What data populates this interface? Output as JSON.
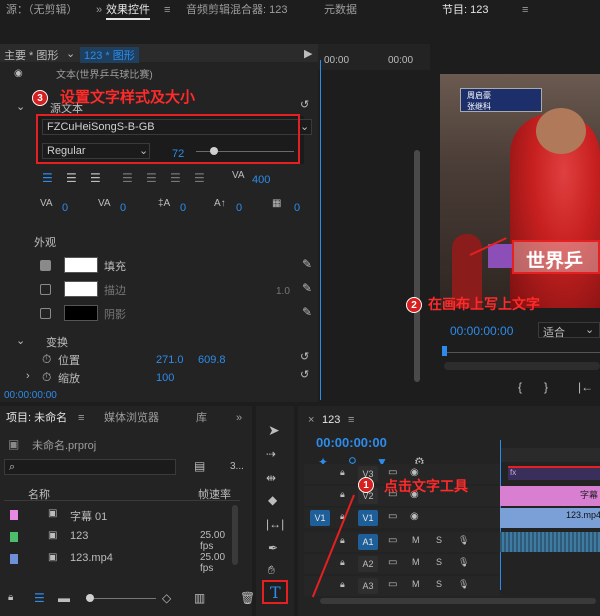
{
  "top_tabs": {
    "source": "源：（无剪辑）",
    "effect_controls": "效果控件",
    "audio_mixer": "音频剪辑混合器: 123",
    "metadata": "元数据",
    "program": "节目: 123"
  },
  "effect_controls": {
    "master": "主要 * 图形",
    "clip": "123 * 图形",
    "time1": "00:00",
    "time2": "00:00",
    "cut_text": "文本(世界乒乓球比赛)",
    "source_text": "源文本",
    "font_family": "FZCuHeiSongS-B-GB",
    "font_style": "Regular",
    "font_size": "72",
    "tracking": "400",
    "val_zero_a": "0",
    "val_zero_b": "0",
    "val_zero_c": "0",
    "val_zero_d": "0",
    "val_zero_e": "0",
    "appearance_title": "外观",
    "fill_label": "填充",
    "stroke_label": "描边",
    "stroke_value": "1.0",
    "shadow_label": "阴影",
    "transform_title": "变换",
    "position_label": "位置",
    "position_x": "271.0",
    "position_y": "609.8",
    "scale_label": "缩放",
    "scale_value": "100",
    "timecode": "00:00:00:00"
  },
  "program": {
    "timecode": "00:00:00:00",
    "fit": "适合",
    "overlay_text": "世界乒",
    "score1": "周启豪",
    "score2": "张继科"
  },
  "project": {
    "tab_project": "项目: 未命名",
    "tab_media": "媒体浏览器",
    "tab_library": "库",
    "file": "未命名.prproj",
    "count": "3...",
    "col_name": "名称",
    "col_rate": "帧速率",
    "items": [
      {
        "name": "字幕 01",
        "rate": "",
        "color": "#e58ae0"
      },
      {
        "name": "123",
        "rate": "25.00 fps",
        "color": "#4dbd6b"
      },
      {
        "name": "123.mp4",
        "rate": "25.00 fps",
        "color": "#6f8fd8"
      }
    ]
  },
  "timeline": {
    "tab": "123",
    "timecode": "00:00:00:00",
    "tracks": [
      "V3",
      "V2",
      "V1",
      "A1",
      "A2",
      "A3"
    ],
    "src_v1": "V1",
    "clip_title": "字幕",
    "clip_video": "123.mp4",
    "fx": "fx"
  },
  "annotations": {
    "a1_num": "1",
    "a1_text": "点击文字工具",
    "a2_num": "2",
    "a2_text": "在画布上写上文字",
    "a3_num": "3",
    "a3_text": "设置文字样式及大小"
  },
  "colors": {
    "accent": "#2d8ceb",
    "annotation": "#e62020",
    "title_clip": "#d97fd2",
    "video_clip": "#7ba0d8"
  }
}
